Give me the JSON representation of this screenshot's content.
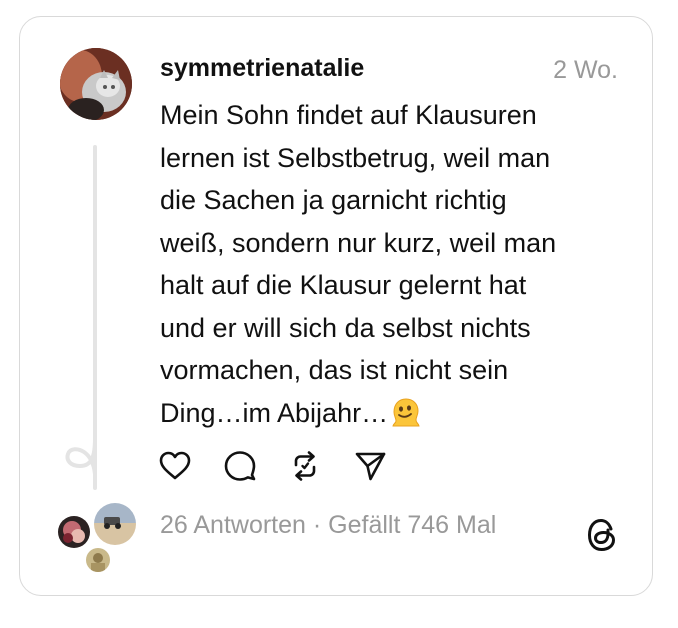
{
  "post": {
    "username": "symmetrienatalie",
    "time": "2 Wo.",
    "lines": [
      "Mein Sohn findet auf Klausuren",
      "lernen ist Selbstbetrug, weil man",
      "die Sachen ja garnicht richtig",
      "weiß, sondern nur kurz, weil man",
      "halt auf die Klausur gelernt hat",
      "und er will sich da selbst nichts",
      "vormachen, das ist nicht sein",
      "Ding…im Abijahr…"
    ],
    "emoji": "melting-face-emoji"
  },
  "actions": [
    {
      "name": "like-button",
      "icon": "heart-icon"
    },
    {
      "name": "reply-button",
      "icon": "comment-icon"
    },
    {
      "name": "repost-button",
      "icon": "repost-icon"
    },
    {
      "name": "share-button",
      "icon": "send-icon"
    }
  ],
  "footer": {
    "replies": "26 Antworten",
    "separator": " · ",
    "likes": "Gefällt 746 Mal"
  },
  "colors": {
    "text": "#111111",
    "muted": "#999999",
    "border": "#d9d9d9",
    "thread_line": "#e4e4e4"
  }
}
